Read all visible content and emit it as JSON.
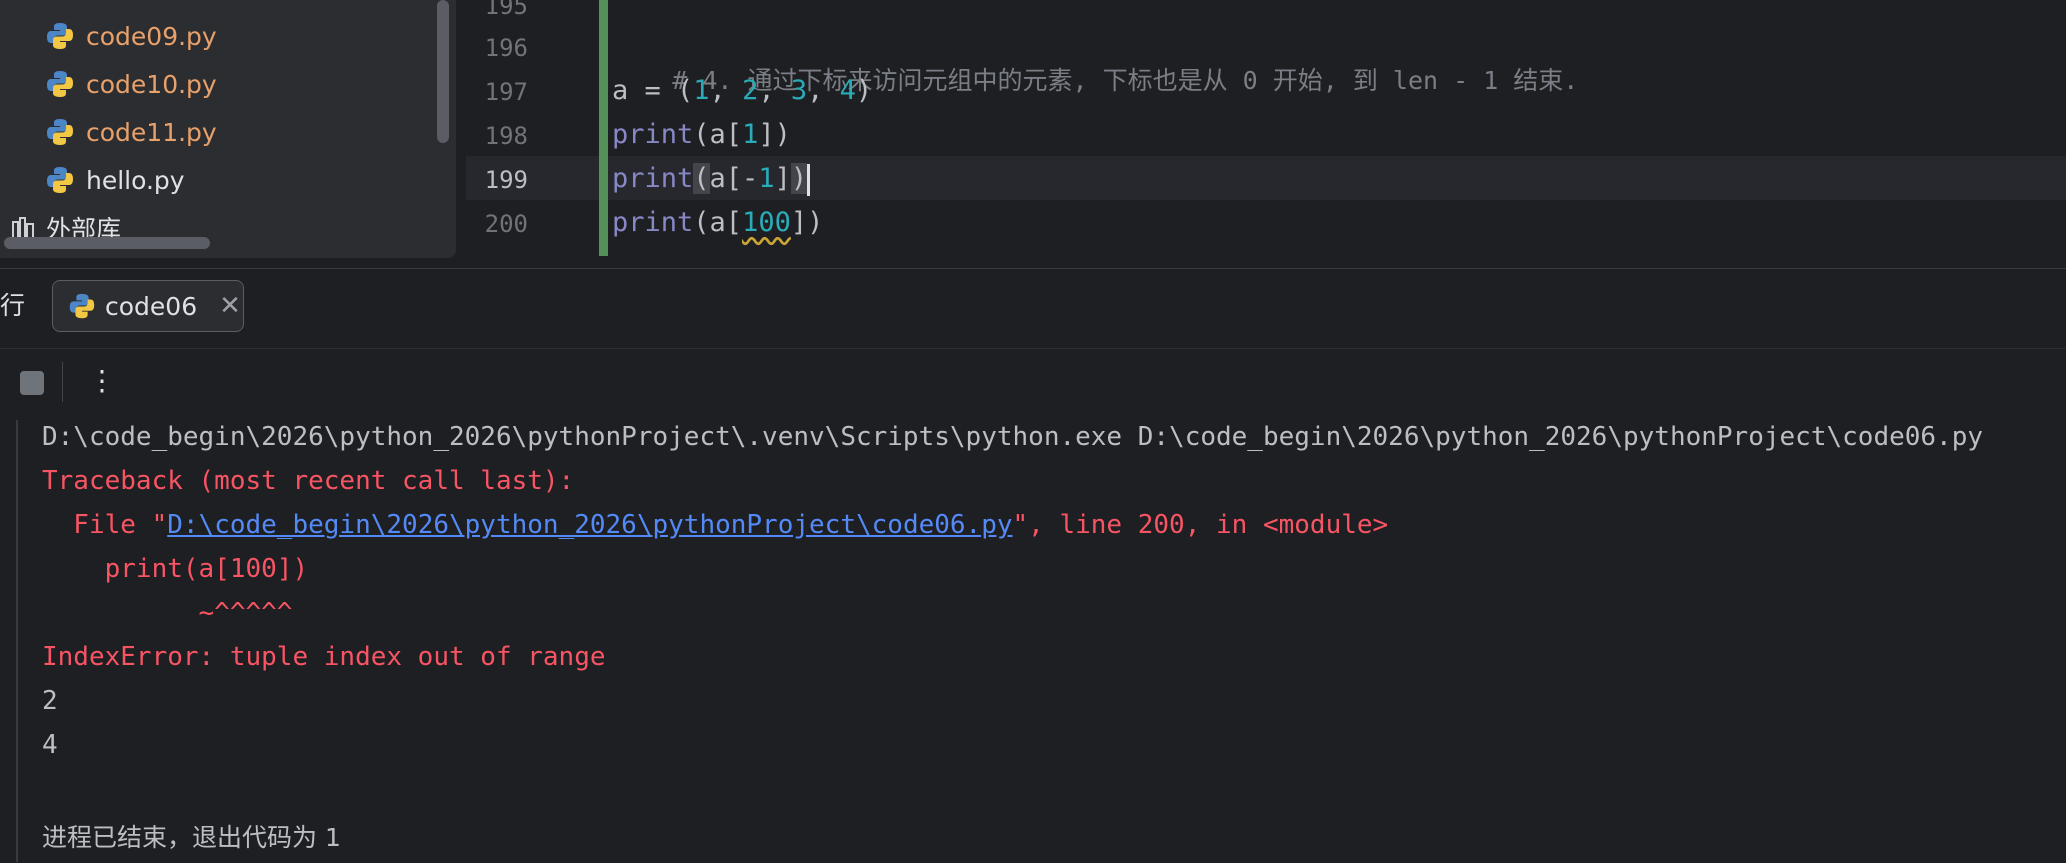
{
  "project_tree": {
    "items": [
      {
        "label": "code09.py",
        "modified": true
      },
      {
        "label": "code10.py",
        "modified": true
      },
      {
        "label": "code11.py",
        "modified": true
      },
      {
        "label": "hello.py",
        "modified": false
      }
    ],
    "external_lib_label": "外部库"
  },
  "editor": {
    "lines": [
      {
        "num": "195"
      },
      {
        "num": "196",
        "comment": "# 4. 通过下标来访问元组中的元素, 下标也是从 0 开始, 到 len - 1 结束."
      },
      {
        "num": "197",
        "a": "a = (",
        "n1": "1",
        "s1": ", ",
        "n2": "2",
        "s2": ", ",
        "n3": "3",
        "s3": ", ",
        "n4": "4",
        "end": ")"
      },
      {
        "num": "198",
        "fn": "print",
        "open": "(a[",
        "n": "1",
        "close": "])"
      },
      {
        "num": "199",
        "fn": "print",
        "open": "(",
        "mid": "a[-",
        "n": "1",
        "close1": "]",
        "close2": ")"
      },
      {
        "num": "200",
        "fn": "print",
        "open": "(a[",
        "n": "100",
        "close": "])"
      }
    ]
  },
  "run": {
    "tool_label": "行",
    "tab_label": "code06",
    "console": {
      "cmd": "D:\\code_begin\\2026\\python_2026\\pythonProject\\.venv\\Scripts\\python.exe D:\\code_begin\\2026\\python_2026\\pythonProject\\code06.py",
      "traceback": "Traceback (most recent call last):",
      "file_prefix": "  File \"",
      "file_link": "D:\\code_begin\\2026\\python_2026\\pythonProject\\code06.py",
      "file_suffix": "\", line 200, in <module>",
      "code_line": "    print(a[100])",
      "caret_line": "          ~^^^^^",
      "error": "IndexError: tuple index out of range",
      "out1": "2",
      "out2": "4",
      "exit": "进程已结束，退出代码为 1"
    }
  },
  "colors": {
    "accent_error": "#f75464",
    "link": "#548af7",
    "modified_file": "#e8a16a",
    "change_bar": "#549159"
  },
  "icons": [
    "python-file-icon",
    "library-icon",
    "stop-icon",
    "more-icon",
    "close-icon"
  ]
}
